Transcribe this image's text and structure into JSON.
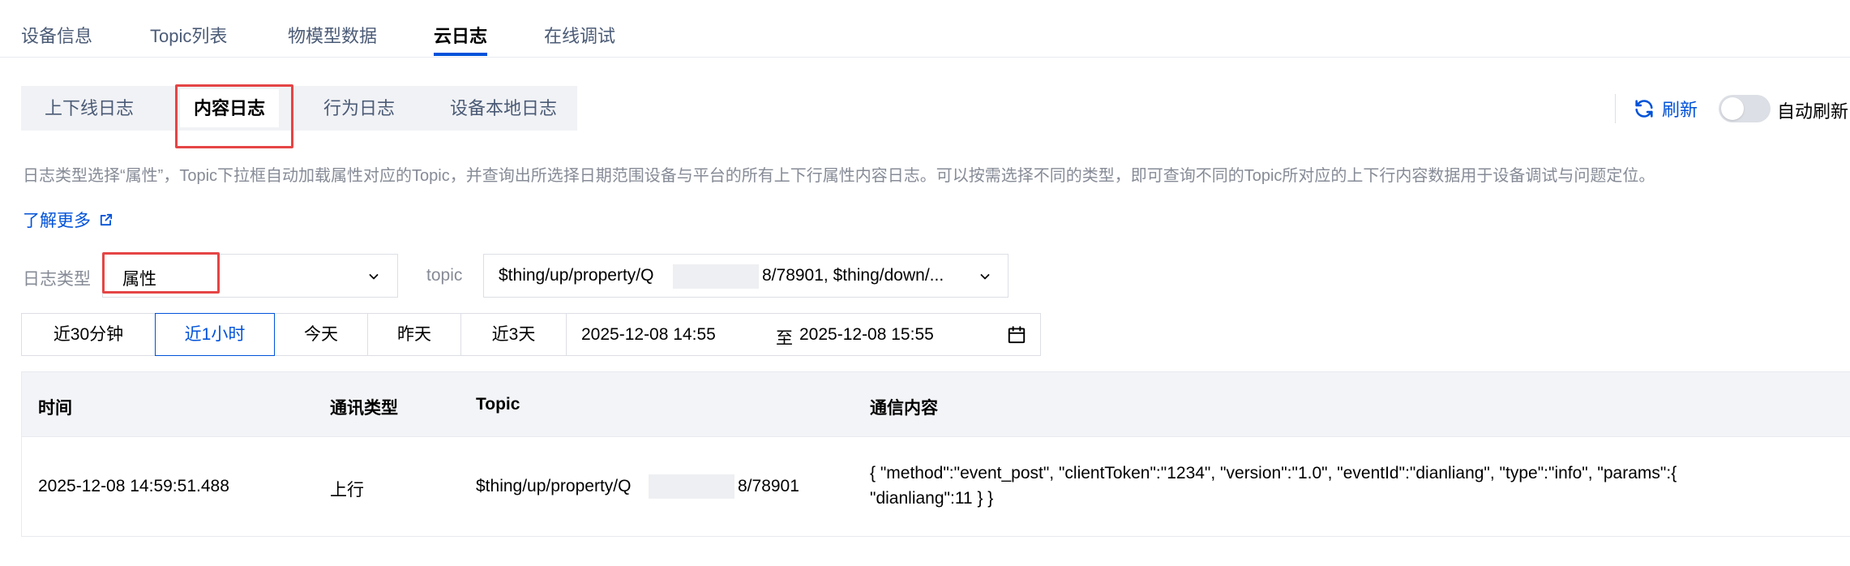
{
  "top_tabs": [
    {
      "label": "设备信息"
    },
    {
      "label": "Topic列表"
    },
    {
      "label": "物模型数据"
    },
    {
      "label": "云日志",
      "active": true
    },
    {
      "label": "在线调试"
    }
  ],
  "sub_tabs": [
    {
      "label": "上下线日志"
    },
    {
      "label": "内容日志",
      "active": true
    },
    {
      "label": "行为日志"
    },
    {
      "label": "设备本地日志"
    }
  ],
  "toolbar": {
    "refresh_label": "刷新",
    "refresh_icon": "refresh-icon",
    "auto_refresh_label": "自动刷新",
    "auto_refresh_on": false
  },
  "description": "日志类型选择“属性”，Topic下拉框自动加载属性对应的Topic，并查询出所选择日期范围设备与平台的所有上下行属性内容日志。可以按需选择不同的类型，即可查询不同的Topic所对应的上下行内容数据用于设备调试与问题定位。",
  "learn_more": {
    "label": "了解更多",
    "icon": "external-link-icon"
  },
  "filters": {
    "log_type_label": "日志类型",
    "log_type_value": "属性",
    "topic_label": "topic",
    "topic_value_prefix": "$thing/up/property/Q",
    "topic_value_suffix": "8/78901, $thing/down/..."
  },
  "time_ranges": [
    {
      "label": "近30分钟"
    },
    {
      "label": "近1小时",
      "active": true
    },
    {
      "label": "今天"
    },
    {
      "label": "昨天"
    },
    {
      "label": "近3天"
    }
  ],
  "date_range": {
    "start": "2025-12-08 14:55",
    "separator": "至",
    "end": "2025-12-08 15:55",
    "icon": "calendar-icon"
  },
  "table": {
    "columns": [
      "时间",
      "通讯类型",
      "Topic",
      "通信内容"
    ],
    "rows": [
      {
        "time": "2025-12-08 14:59:51.488",
        "type": "上行",
        "topic_prefix": "$thing/up/property/Q",
        "topic_suffix": "8/78901",
        "content_line1": "{ \"method\":\"event_post\", \"clientToken\":\"1234\", \"version\":\"1.0\", \"eventId\":\"dianliang\", \"type\":\"info\", \"params\":{",
        "content_line2": "\"dianliang\":11 } }"
      }
    ]
  },
  "colors": {
    "accent": "#0052d9",
    "highlight_box": "#e54545",
    "muted_text": "#868b96"
  }
}
